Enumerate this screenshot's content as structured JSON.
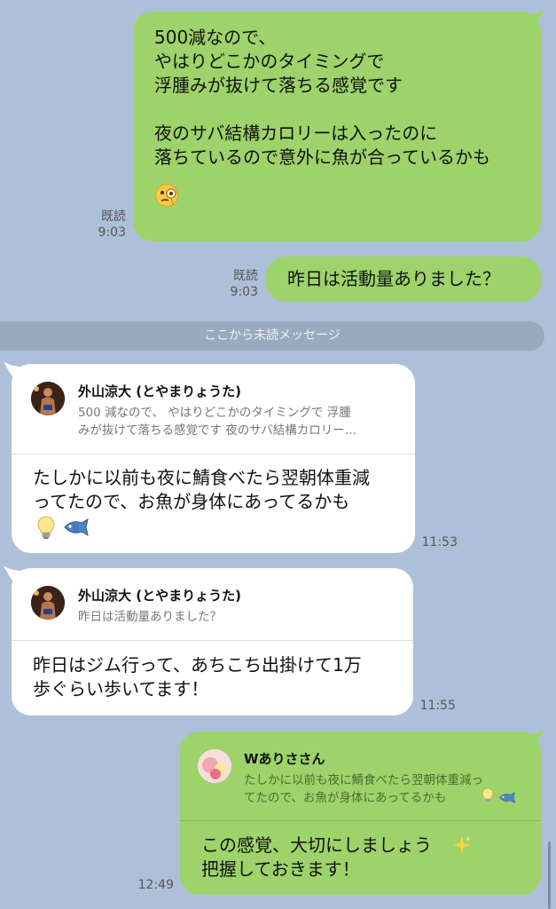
{
  "colors": {
    "background": "#aec0d9",
    "sent_bubble": "#9dd36a",
    "received_bubble": "#ffffff",
    "divider": "#98aabf"
  },
  "messages": {
    "m1": {
      "text": "500減なので、\nやはりどこかのタイミングで\n浮腫みが抜けて落ちる感覚です\n\n夜のサバ結構カロリーは入ったのに\n落ちているので意外に魚が合っているかも",
      "emoji": "monocle-face",
      "read": "既読",
      "time": "9:03"
    },
    "m2": {
      "text": "昨日は活動量ありました？",
      "read": "既読",
      "time": "9:03"
    },
    "divider_label": "ここから未読メッセージ",
    "m3": {
      "quote_name": "外山涼大 (とやまりょうた)",
      "quote_text": "500 減なので、 やはりどこかのタイミングで 浮腫\nみが抜けて落ちる感覚です 夜のサバ結構カロリー…",
      "text": "たしかに以前も夜に鯖食べたら翌朝体重減\nってたので、お魚が身体にあってるかも",
      "emojis": [
        "light-bulb",
        "fish"
      ],
      "time": "11:53"
    },
    "m4": {
      "quote_name": "外山涼大 (とやまりょうた)",
      "quote_text": "昨日は活動量ありました？",
      "text": "昨日はジム行って、あちこち出掛けて1万\n歩ぐらい歩いてます！",
      "time": "11:55"
    },
    "m5": {
      "quote_name": "Wありささん",
      "quote_text": "たしかに以前も夜に鯖食べたら翌朝体重減っ\nてたので、お魚が身体にあってるかも",
      "text": "この感覚、大切にしましょう\n把握しておきます！",
      "emoji": "sparkles",
      "time": "12:49"
    }
  }
}
